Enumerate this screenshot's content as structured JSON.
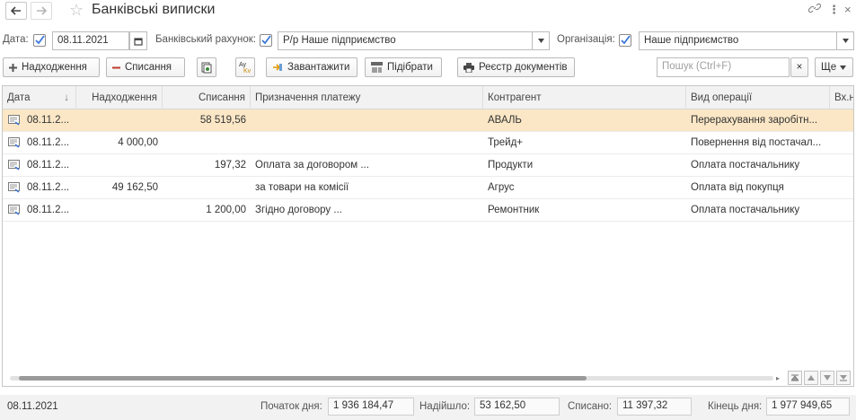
{
  "window": {
    "title": "Банківські виписки"
  },
  "filters": {
    "date_label": "Дата:",
    "date_value": "08.11.2021",
    "account_label": "Банківський рахунок:",
    "account_value": "Р/р Наше підприємство",
    "org_label": "Організація:",
    "org_value": "Наше підприємство"
  },
  "toolbar": {
    "income_label": "Надходження",
    "writeoff_label": "Списання",
    "load_label": "Завантажити",
    "select_label": "Підібрати",
    "registry_label": "Реєстр документів",
    "search_placeholder": "Пошук (Ctrl+F)",
    "more_label": "Ще"
  },
  "table": {
    "columns": [
      "Дата",
      "Надходження",
      "Списання",
      "Призначення платежу",
      "Контрагент",
      "Вид операції",
      "Вх.н"
    ],
    "rows": [
      {
        "date": "08.11.2...",
        "income": "",
        "writeoff": "58 519,56",
        "purpose": "",
        "counterparty": "АВАЛЬ",
        "operation": "Перерахування заробітн..."
      },
      {
        "date": "08.11.2...",
        "income": "4 000,00",
        "writeoff": "",
        "purpose": "",
        "counterparty": "Трейд+",
        "operation": "Повернення від постачал..."
      },
      {
        "date": "08.11.2...",
        "income": "",
        "writeoff": "197,32",
        "purpose": "Оплата за договором ...",
        "counterparty": "Продукти",
        "operation": "Оплата постачальнику"
      },
      {
        "date": "08.11.2...",
        "income": "49 162,50",
        "writeoff": "",
        "purpose": "за товари на комісії",
        "counterparty": "Агрус",
        "operation": "Оплата від покупця"
      },
      {
        "date": "08.11.2...",
        "income": "",
        "writeoff": "1 200,00",
        "purpose": "Згідно договору ...",
        "counterparty": "Ремонтник",
        "operation": "Оплата постачальнику"
      }
    ]
  },
  "footer": {
    "date": "08.11.2021",
    "start_label": "Початок дня:",
    "start_value": "1 936 184,47",
    "received_label": "Надійшло:",
    "received_value": "53 162,50",
    "spent_label": "Списано:",
    "spent_value": "11 397,32",
    "end_label": "Кінець дня:",
    "end_value": "1 977 949,65"
  },
  "colors": {
    "selected_row": "#fbe7c6",
    "header_bg": "#f2f2f2",
    "checkbox_accent": "#3c78d8"
  }
}
